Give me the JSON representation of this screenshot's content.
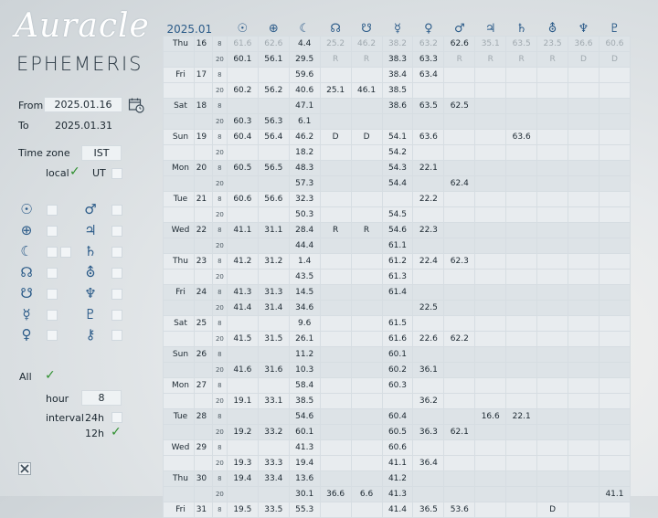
{
  "app": {
    "logo_line1": "Auracle",
    "logo_line2": "EPHEMERIS"
  },
  "sidebar": {
    "from_label": "From",
    "from_value": "2025.01.16",
    "to_label": "To",
    "to_value": "2025.01.31",
    "timezone_label": "Time zone",
    "timezone_value": "IST",
    "local_label": "local",
    "ut_label": "UT",
    "planets_left": [
      {
        "glyph": "☉",
        "name": "sun",
        "checked": false,
        "extra": false
      },
      {
        "glyph": "⊕",
        "name": "earth",
        "checked": false,
        "extra": false
      },
      {
        "glyph": "☾",
        "name": "moon",
        "checked": false,
        "extra": true
      },
      {
        "glyph": "☊",
        "name": "north-node",
        "checked": false,
        "extra": false
      },
      {
        "glyph": "☋",
        "name": "south-node",
        "checked": false,
        "extra": false
      },
      {
        "glyph": "☿",
        "name": "mercury",
        "checked": false,
        "extra": false
      },
      {
        "glyph": "♀",
        "name": "venus",
        "checked": false,
        "extra": false
      }
    ],
    "planets_right": [
      {
        "glyph": "♂",
        "name": "mars"
      },
      {
        "glyph": "♃",
        "name": "jupiter"
      },
      {
        "glyph": "♄",
        "name": "saturn"
      },
      {
        "glyph": "⛢",
        "name": "uranus"
      },
      {
        "glyph": "♆",
        "name": "neptune"
      },
      {
        "glyph": "♇",
        "name": "pluto"
      },
      {
        "glyph": "⚷",
        "name": "chiron"
      }
    ],
    "all_label": "All",
    "hour_label": "hour",
    "hour_value": "8",
    "interval_label": "interval",
    "interval_24h": "24h",
    "interval_12h": "12h"
  },
  "table": {
    "header_date": "2025.01",
    "header_glyphs": [
      "☉",
      "⊕",
      "☾",
      "☊",
      "☋",
      "☿",
      "♀",
      "♂",
      "♃",
      "♄",
      "⛢",
      "♆",
      "♇"
    ],
    "rows": [
      {
        "day": "Thu",
        "date": "16",
        "hour": "8",
        "vals": [
          "61.6",
          "62.6",
          "4.4",
          "25.2",
          "46.2",
          "38.2",
          "63.2",
          "62.6",
          "35.1",
          "63.5",
          "23.5",
          "36.6",
          "60.6"
        ],
        "grey": [
          true,
          true,
          false,
          true,
          true,
          true,
          true,
          false,
          true,
          true,
          true,
          true,
          true
        ]
      },
      {
        "day": "",
        "date": "",
        "hour": "20",
        "vals": [
          "60.1",
          "56.1",
          "29.5",
          "R",
          "R",
          "38.3",
          "63.3",
          "R",
          "R",
          "R",
          "R",
          "D",
          "D"
        ],
        "grey": [
          false,
          false,
          false,
          true,
          true,
          false,
          false,
          true,
          true,
          true,
          true,
          true,
          true
        ]
      },
      {
        "day": "Fri",
        "date": "17",
        "hour": "8",
        "vals": [
          "",
          "",
          "59.6",
          "",
          "",
          "38.4",
          "63.4",
          "",
          "",
          "",
          "",
          "",
          ""
        ]
      },
      {
        "day": "",
        "date": "",
        "hour": "20",
        "vals": [
          "60.2",
          "56.2",
          "40.6",
          "25.1",
          "46.1",
          "38.5",
          "",
          "",
          "",
          "",
          "",
          "",
          ""
        ]
      },
      {
        "day": "Sat",
        "date": "18",
        "hour": "8",
        "vals": [
          "",
          "",
          "47.1",
          "",
          "",
          "38.6",
          "63.5",
          "62.5",
          "",
          "",
          "",
          "",
          ""
        ]
      },
      {
        "day": "",
        "date": "",
        "hour": "20",
        "vals": [
          "60.3",
          "56.3",
          "6.1",
          "",
          "",
          "",
          "",
          "",
          "",
          "",
          "",
          "",
          ""
        ]
      },
      {
        "day": "Sun",
        "date": "19",
        "hour": "8",
        "vals": [
          "60.4",
          "56.4",
          "46.2",
          "D",
          "D",
          "54.1",
          "63.6",
          "",
          "",
          "63.6",
          "",
          "",
          ""
        ]
      },
      {
        "day": "",
        "date": "",
        "hour": "20",
        "vals": [
          "",
          "",
          "18.2",
          "",
          "",
          "54.2",
          "",
          "",
          "",
          "",
          "",
          "",
          ""
        ]
      },
      {
        "day": "Mon",
        "date": "20",
        "hour": "8",
        "vals": [
          "60.5",
          "56.5",
          "48.3",
          "",
          "",
          "54.3",
          "22.1",
          "",
          "",
          "",
          "",
          "",
          ""
        ]
      },
      {
        "day": "",
        "date": "",
        "hour": "20",
        "vals": [
          "",
          "",
          "57.3",
          "",
          "",
          "54.4",
          "",
          "62.4",
          "",
          "",
          "",
          "",
          ""
        ]
      },
      {
        "day": "Tue",
        "date": "21",
        "hour": "8",
        "vals": [
          "60.6",
          "56.6",
          "32.3",
          "",
          "",
          "",
          "22.2",
          "",
          "",
          "",
          "",
          "",
          ""
        ]
      },
      {
        "day": "",
        "date": "",
        "hour": "20",
        "vals": [
          "",
          "",
          "50.3",
          "",
          "",
          "54.5",
          "",
          "",
          "",
          "",
          "",
          "",
          ""
        ]
      },
      {
        "day": "Wed",
        "date": "22",
        "hour": "8",
        "vals": [
          "41.1",
          "31.1",
          "28.4",
          "R",
          "R",
          "54.6",
          "22.3",
          "",
          "",
          "",
          "",
          "",
          ""
        ]
      },
      {
        "day": "",
        "date": "",
        "hour": "20",
        "vals": [
          "",
          "",
          "44.4",
          "",
          "",
          "61.1",
          "",
          "",
          "",
          "",
          "",
          "",
          ""
        ]
      },
      {
        "day": "Thu",
        "date": "23",
        "hour": "8",
        "vals": [
          "41.2",
          "31.2",
          "1.4",
          "",
          "",
          "61.2",
          "22.4",
          "62.3",
          "",
          "",
          "",
          "",
          ""
        ]
      },
      {
        "day": "",
        "date": "",
        "hour": "20",
        "vals": [
          "",
          "",
          "43.5",
          "",
          "",
          "61.3",
          "",
          "",
          "",
          "",
          "",
          "",
          ""
        ]
      },
      {
        "day": "Fri",
        "date": "24",
        "hour": "8",
        "vals": [
          "41.3",
          "31.3",
          "14.5",
          "",
          "",
          "61.4",
          "",
          "",
          "",
          "",
          "",
          "",
          ""
        ]
      },
      {
        "day": "",
        "date": "",
        "hour": "20",
        "vals": [
          "41.4",
          "31.4",
          "34.6",
          "",
          "",
          "",
          "22.5",
          "",
          "",
          "",
          "",
          "",
          ""
        ]
      },
      {
        "day": "Sat",
        "date": "25",
        "hour": "8",
        "vals": [
          "",
          "",
          "9.6",
          "",
          "",
          "61.5",
          "",
          "",
          "",
          "",
          "",
          "",
          ""
        ]
      },
      {
        "day": "",
        "date": "",
        "hour": "20",
        "vals": [
          "41.5",
          "31.5",
          "26.1",
          "",
          "",
          "61.6",
          "22.6",
          "62.2",
          "",
          "",
          "",
          "",
          ""
        ]
      },
      {
        "day": "Sun",
        "date": "26",
        "hour": "8",
        "vals": [
          "",
          "",
          "11.2",
          "",
          "",
          "60.1",
          "",
          "",
          "",
          "",
          "",
          "",
          ""
        ]
      },
      {
        "day": "",
        "date": "",
        "hour": "20",
        "vals": [
          "41.6",
          "31.6",
          "10.3",
          "",
          "",
          "60.2",
          "36.1",
          "",
          "",
          "",
          "",
          "",
          ""
        ]
      },
      {
        "day": "Mon",
        "date": "27",
        "hour": "8",
        "vals": [
          "",
          "",
          "58.4",
          "",
          "",
          "60.3",
          "",
          "",
          "",
          "",
          "",
          "",
          ""
        ]
      },
      {
        "day": "",
        "date": "",
        "hour": "20",
        "vals": [
          "19.1",
          "33.1",
          "38.5",
          "",
          "",
          "",
          "36.2",
          "",
          "",
          "",
          "",
          "",
          ""
        ]
      },
      {
        "day": "Tue",
        "date": "28",
        "hour": "8",
        "vals": [
          "",
          "",
          "54.6",
          "",
          "",
          "60.4",
          "",
          "",
          "16.6",
          "22.1",
          "",
          "",
          ""
        ]
      },
      {
        "day": "",
        "date": "",
        "hour": "20",
        "vals": [
          "19.2",
          "33.2",
          "60.1",
          "",
          "",
          "60.5",
          "36.3",
          "62.1",
          "",
          "",
          "",
          "",
          ""
        ]
      },
      {
        "day": "Wed",
        "date": "29",
        "hour": "8",
        "vals": [
          "",
          "",
          "41.3",
          "",
          "",
          "60.6",
          "",
          "",
          "",
          "",
          "",
          "",
          ""
        ]
      },
      {
        "day": "",
        "date": "",
        "hour": "20",
        "vals": [
          "19.3",
          "33.3",
          "19.4",
          "",
          "",
          "41.1",
          "36.4",
          "",
          "",
          "",
          "",
          "",
          ""
        ]
      },
      {
        "day": "Thu",
        "date": "30",
        "hour": "8",
        "vals": [
          "19.4",
          "33.4",
          "13.6",
          "",
          "",
          "41.2",
          "",
          "",
          "",
          "",
          "",
          "",
          ""
        ]
      },
      {
        "day": "",
        "date": "",
        "hour": "20",
        "vals": [
          "",
          "",
          "30.1",
          "36.6",
          "6.6",
          "41.3",
          "",
          "",
          "",
          "",
          "",
          "",
          "41.1"
        ]
      },
      {
        "day": "Fri",
        "date": "31",
        "hour": "8",
        "vals": [
          "19.5",
          "33.5",
          "55.3",
          "",
          "",
          "41.4",
          "36.5",
          "53.6",
          "",
          "",
          "D",
          "",
          ""
        ]
      }
    ]
  }
}
